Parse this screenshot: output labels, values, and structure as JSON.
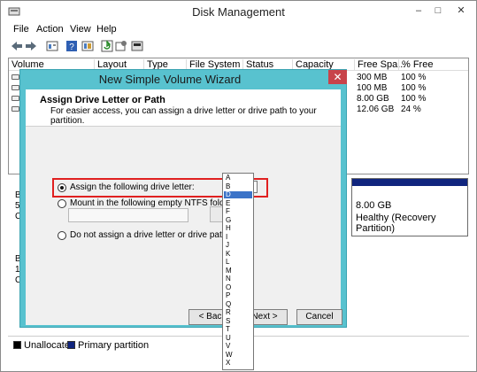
{
  "window": {
    "title": "Disk Management",
    "controls": {
      "minimize": "–",
      "maximize": "□",
      "close": "✕"
    }
  },
  "menu": [
    "File",
    "Action",
    "View",
    "Help"
  ],
  "toolbar": [
    "back-icon",
    "forward-icon",
    "properties-icon",
    "help-icon",
    "refresh-icon",
    "settings-icon",
    "disk-icon"
  ],
  "volume_table": {
    "columns": [
      "Volume",
      "Layout",
      "Type",
      "File System",
      "Status",
      "Capacity",
      "Free Spa...",
      "% Free"
    ],
    "rows": [
      {
        "free": "300 MB",
        "pct": "100 %"
      },
      {
        "free": "100 MB",
        "pct": "100 %"
      },
      {
        "free": "8.00 GB",
        "pct": "100 %"
      },
      {
        "free": "12.06 GB",
        "pct": "24 %"
      }
    ]
  },
  "disk_area": {
    "side_letters_1": [
      "B",
      "5",
      "C"
    ],
    "side_letters_2": [
      "B",
      "1",
      "C"
    ],
    "recovery": {
      "size": "8.00 GB",
      "status": "Healthy (Recovery Partition)"
    }
  },
  "legend": [
    {
      "label": "Unallocated",
      "color": "#000000"
    },
    {
      "label": "Primary partition",
      "color": "#10257e"
    }
  ],
  "wizard": {
    "title": "New Simple Volume Wizard",
    "close": "✕",
    "heading": "Assign Drive Letter or Path",
    "subtitle": "For easier access, you can assign a drive letter or drive path to your partition.",
    "option_assign": "Assign the following drive letter:",
    "option_mount": "Mount in the following empty NTFS folder:",
    "option_none": "Do not assign a drive letter or drive path",
    "selected_letter": "D",
    "browse": "Br",
    "back": "< Back",
    "next": "Next >",
    "cancel": "Cancel"
  },
  "drive_list": {
    "items": [
      "A",
      "B",
      "D",
      "E",
      "F",
      "G",
      "H",
      "I",
      "J",
      "K",
      "L",
      "M",
      "N",
      "O",
      "P",
      "Q",
      "R",
      "S",
      "T",
      "U",
      "V",
      "W",
      "X"
    ],
    "selected": "D"
  }
}
